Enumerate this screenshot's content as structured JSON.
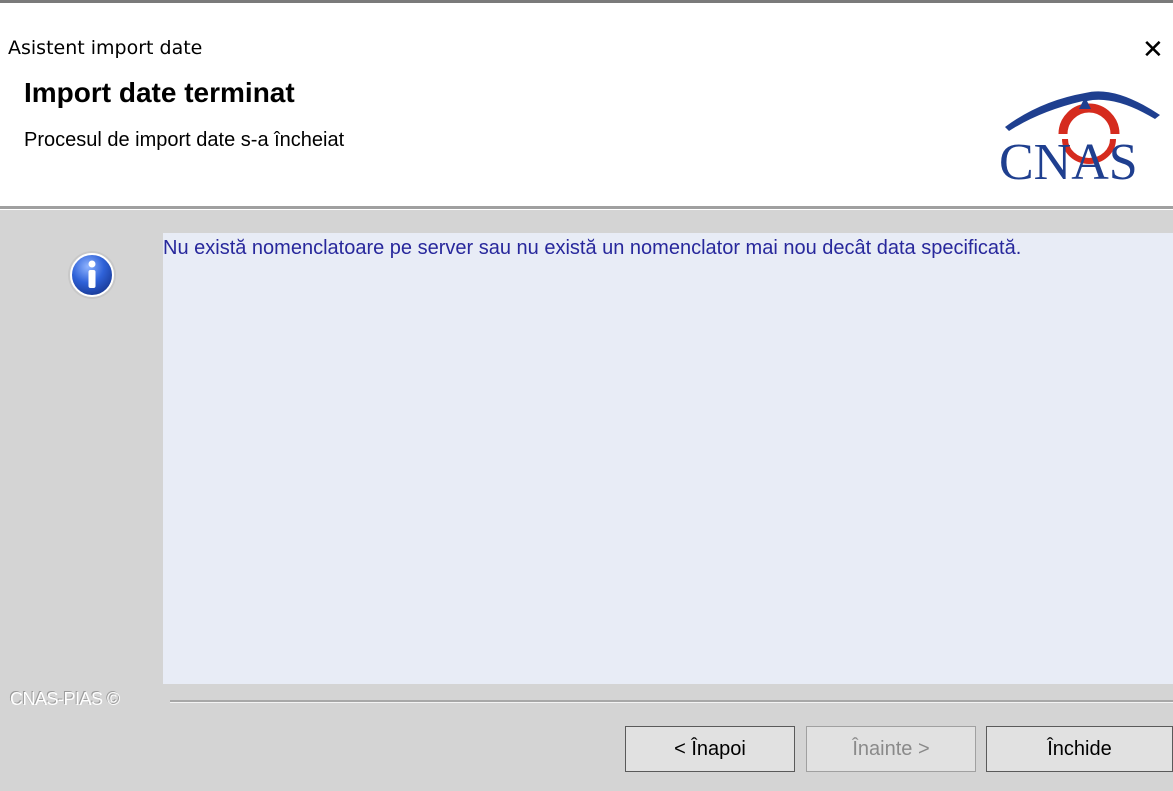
{
  "window": {
    "title": "Asistent import date",
    "close_glyph": "✕"
  },
  "header": {
    "title": "Import date terminat",
    "subtitle": "Procesul de import date s-a încheiat",
    "logo_text": "CNAS",
    "logo_colors": {
      "arc": "#d52b1e",
      "roof": "#1f3f8f",
      "text": "#1f3f8f"
    }
  },
  "content": {
    "icon": "info-icon",
    "message": "Nu există nomenclatoare pe server sau nu există un nomenclator mai nou decât data specificată.",
    "message_color": "#28289c",
    "group_label": "CNAS-PIAS ©"
  },
  "buttons": {
    "back": "< Înapoi",
    "next": "Înainte >",
    "close": "Închide"
  }
}
